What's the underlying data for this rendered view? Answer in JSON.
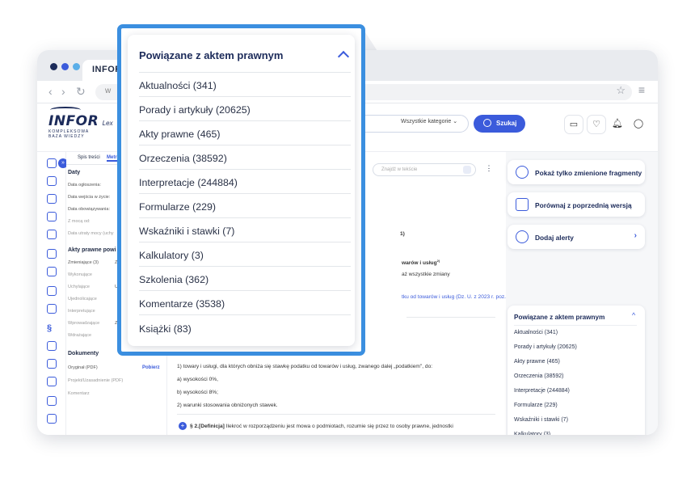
{
  "browser": {
    "tab_label": "INFOR",
    "url": "w"
  },
  "logo": {
    "name": "INFOR",
    "suffix": "Lex",
    "sub1": "KOMPLEKSOWA",
    "sub2": "BAZA WIEDZY"
  },
  "header": {
    "category_select": "Wszystkie kategorie",
    "search_button": "Szukaj"
  },
  "metrics": {
    "tab_toc": "Spis treści",
    "tab_metrics": "Metr",
    "dates_heading": "Daty",
    "dates": [
      "Data ogłoszenia:",
      "Data wejścia w życie:",
      "Data obowiązywania:",
      "Z mocą od:",
      "Data utraty mocy (uchy"
    ],
    "related_heading": "Akty prawne powi",
    "related": [
      "Zmieniające (3)",
      "Wykonujące",
      "Uchylające",
      "Ujednolicające",
      "Interpretujące",
      "Wprowadzające",
      "Wdrażające"
    ],
    "related_right": [
      "Z",
      "",
      "U",
      "",
      "",
      "Z",
      ""
    ],
    "docs_heading": "Dokumenty",
    "docs": [
      "Oryginał (PDF)",
      "Projekt/Uzasadnienie (PDF)",
      "Komentarz"
    ],
    "download_link": "Pobierz"
  },
  "doc": {
    "find_placeholder": "Znajdź w tekście",
    "frag1": "1)",
    "frag2": "warów i usług",
    "frag2_sup": "2)",
    "frag3": "aż wszystkie zmiany",
    "frag4": "tku od towarów i usług (Dz. U. z 2023 r. poz.",
    "para1": "1) towary i usługi, dla których obniża się stawkę podatku od towarów i usług, zwanego dalej „podatkiem\", do:",
    "para2": "a) wysokości 0%,",
    "para3": "b) wysokości 8%;",
    "para4": "2) warunki stosowania obniżonych stawek.",
    "para5_bold": "§ 2.[Definicja]",
    "para5": " Ilekroć w rozporządzeniu jest mowa o podmiotach, rozumie się przez to osoby prawne, jednostki"
  },
  "right": {
    "card1": "Pokaż tylko zmienione fragmenty",
    "card2": "Porównaj z poprzednią wersją",
    "card3": "Dodaj alerty",
    "chevron_right": "›",
    "chevron_up": "^"
  },
  "related": {
    "title": "Powiązane z aktem prawnym",
    "items": [
      "Aktualności (341)",
      "Porady i artykuły (20625)",
      "Akty prawne (465)",
      "Orzeczenia (38592)",
      "Interpretacje (244884)",
      "Formularze (229)",
      "Wskaźniki i stawki (7)",
      "Kalkulatory (3)",
      "Szkolenia (362)",
      "Komentarze (3538)",
      "Książki (83)"
    ]
  },
  "colors": {
    "accent": "#3b5bdb",
    "frame": "#3b8fe0",
    "navy": "#1c2b5a"
  }
}
